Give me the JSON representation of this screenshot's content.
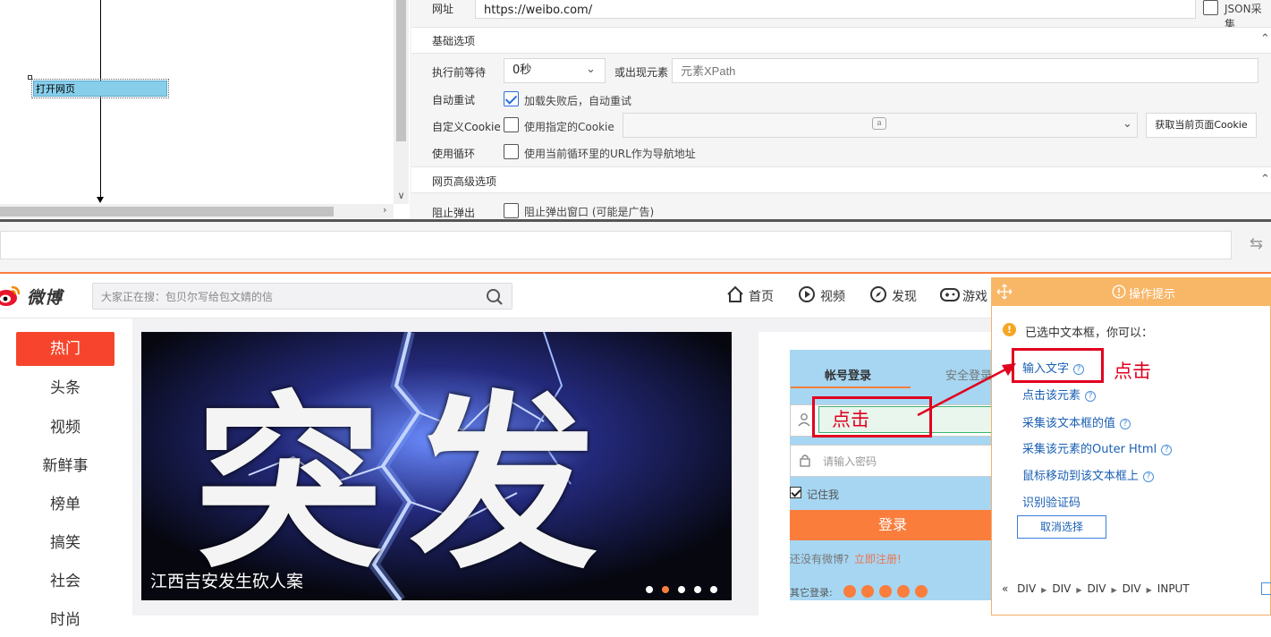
{
  "flow": {
    "node_label": "打开网页"
  },
  "settings": {
    "url_label": "网址",
    "url_value": "https://weibo.com/",
    "json_label": "JSON采集",
    "basic_section": "基础选项",
    "wait_label": "执行前等待",
    "wait_value": "0秒",
    "or_element_label": "或出现元素",
    "xpath_placeholder": "元素XPath",
    "retry_label": "自动重试",
    "retry_option": "加载失败后，自动重试",
    "cookie_label": "自定义Cookie",
    "cookie_option": "使用指定的Cookie",
    "cookie_badge": "a",
    "get_cookie_button": "获取当前页面Cookie",
    "loop_label": "使用循环",
    "loop_option": "使用当前循环里的URL作为导航地址",
    "advanced_section": "网页高级选项",
    "popup_label": "阻止弹出",
    "popup_option": "阻止弹出窗口 (可能是广告)"
  },
  "weibo": {
    "logo_text": "微博",
    "search_placeholder": "大家正在搜：包贝尔写给包文婧的信",
    "nav": [
      {
        "label": "首页",
        "icon": "home-icon"
      },
      {
        "label": "视频",
        "icon": "video-icon"
      },
      {
        "label": "发现",
        "icon": "compass-icon"
      },
      {
        "label": "游戏",
        "icon": "gamepad-icon"
      }
    ],
    "sidebar": [
      "热门",
      "头条",
      "视频",
      "新鲜事",
      "榜单",
      "搞笑",
      "社会",
      "时尚"
    ],
    "banner_text": "突发",
    "banner_caption": "江西吉安发生砍人案",
    "banner_dots": 5,
    "banner_active_dot": 2,
    "login": {
      "tab_account": "帐号登录",
      "tab_safe": "安全登录",
      "password_placeholder": "请输入密码",
      "remember": "记住我",
      "login_button": "登录",
      "no_account": "还没有微博?",
      "register": "立即注册!",
      "other_login": "其它登录:"
    }
  },
  "annotations": {
    "click_label_input": "点击",
    "click_label_menu": "点击"
  },
  "hint": {
    "title": "操作提示",
    "message": "已选中文本框，你可以：",
    "options": [
      "输入文字",
      "点击该元素",
      "采集该文本框的值",
      "采集该元素的Outer Html",
      "鼠标移动到该文本框上",
      "识别验证码"
    ],
    "cancel": "取消选择",
    "crumbs": [
      "DIV",
      "DIV",
      "DIV",
      "DIV",
      "INPUT"
    ]
  },
  "colors": {
    "weibo_orange": "#fa7d3c",
    "hot_red": "#f6452c",
    "annotation_red": "#e1001e",
    "hint_header": "#f8b667",
    "link_blue": "#1a5fb4"
  }
}
